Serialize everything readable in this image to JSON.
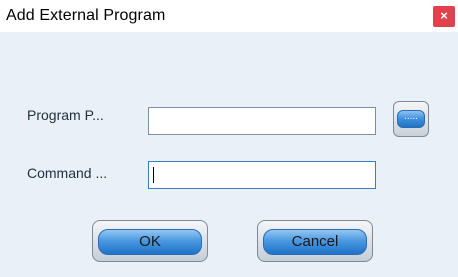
{
  "window": {
    "title": "Add External Program",
    "close_glyph": "×"
  },
  "form": {
    "program_path": {
      "label": "Program P...",
      "value": ""
    },
    "command": {
      "label": "Command ...",
      "value": ""
    },
    "browse_label": "....."
  },
  "buttons": {
    "ok_label": "OK",
    "cancel_label": "Cancel"
  },
  "colors": {
    "accent": "#3d8fdc",
    "close_button": "#e0414a",
    "dialog_background": "#e9f0f8"
  },
  "icons": {
    "close": "close-icon"
  }
}
